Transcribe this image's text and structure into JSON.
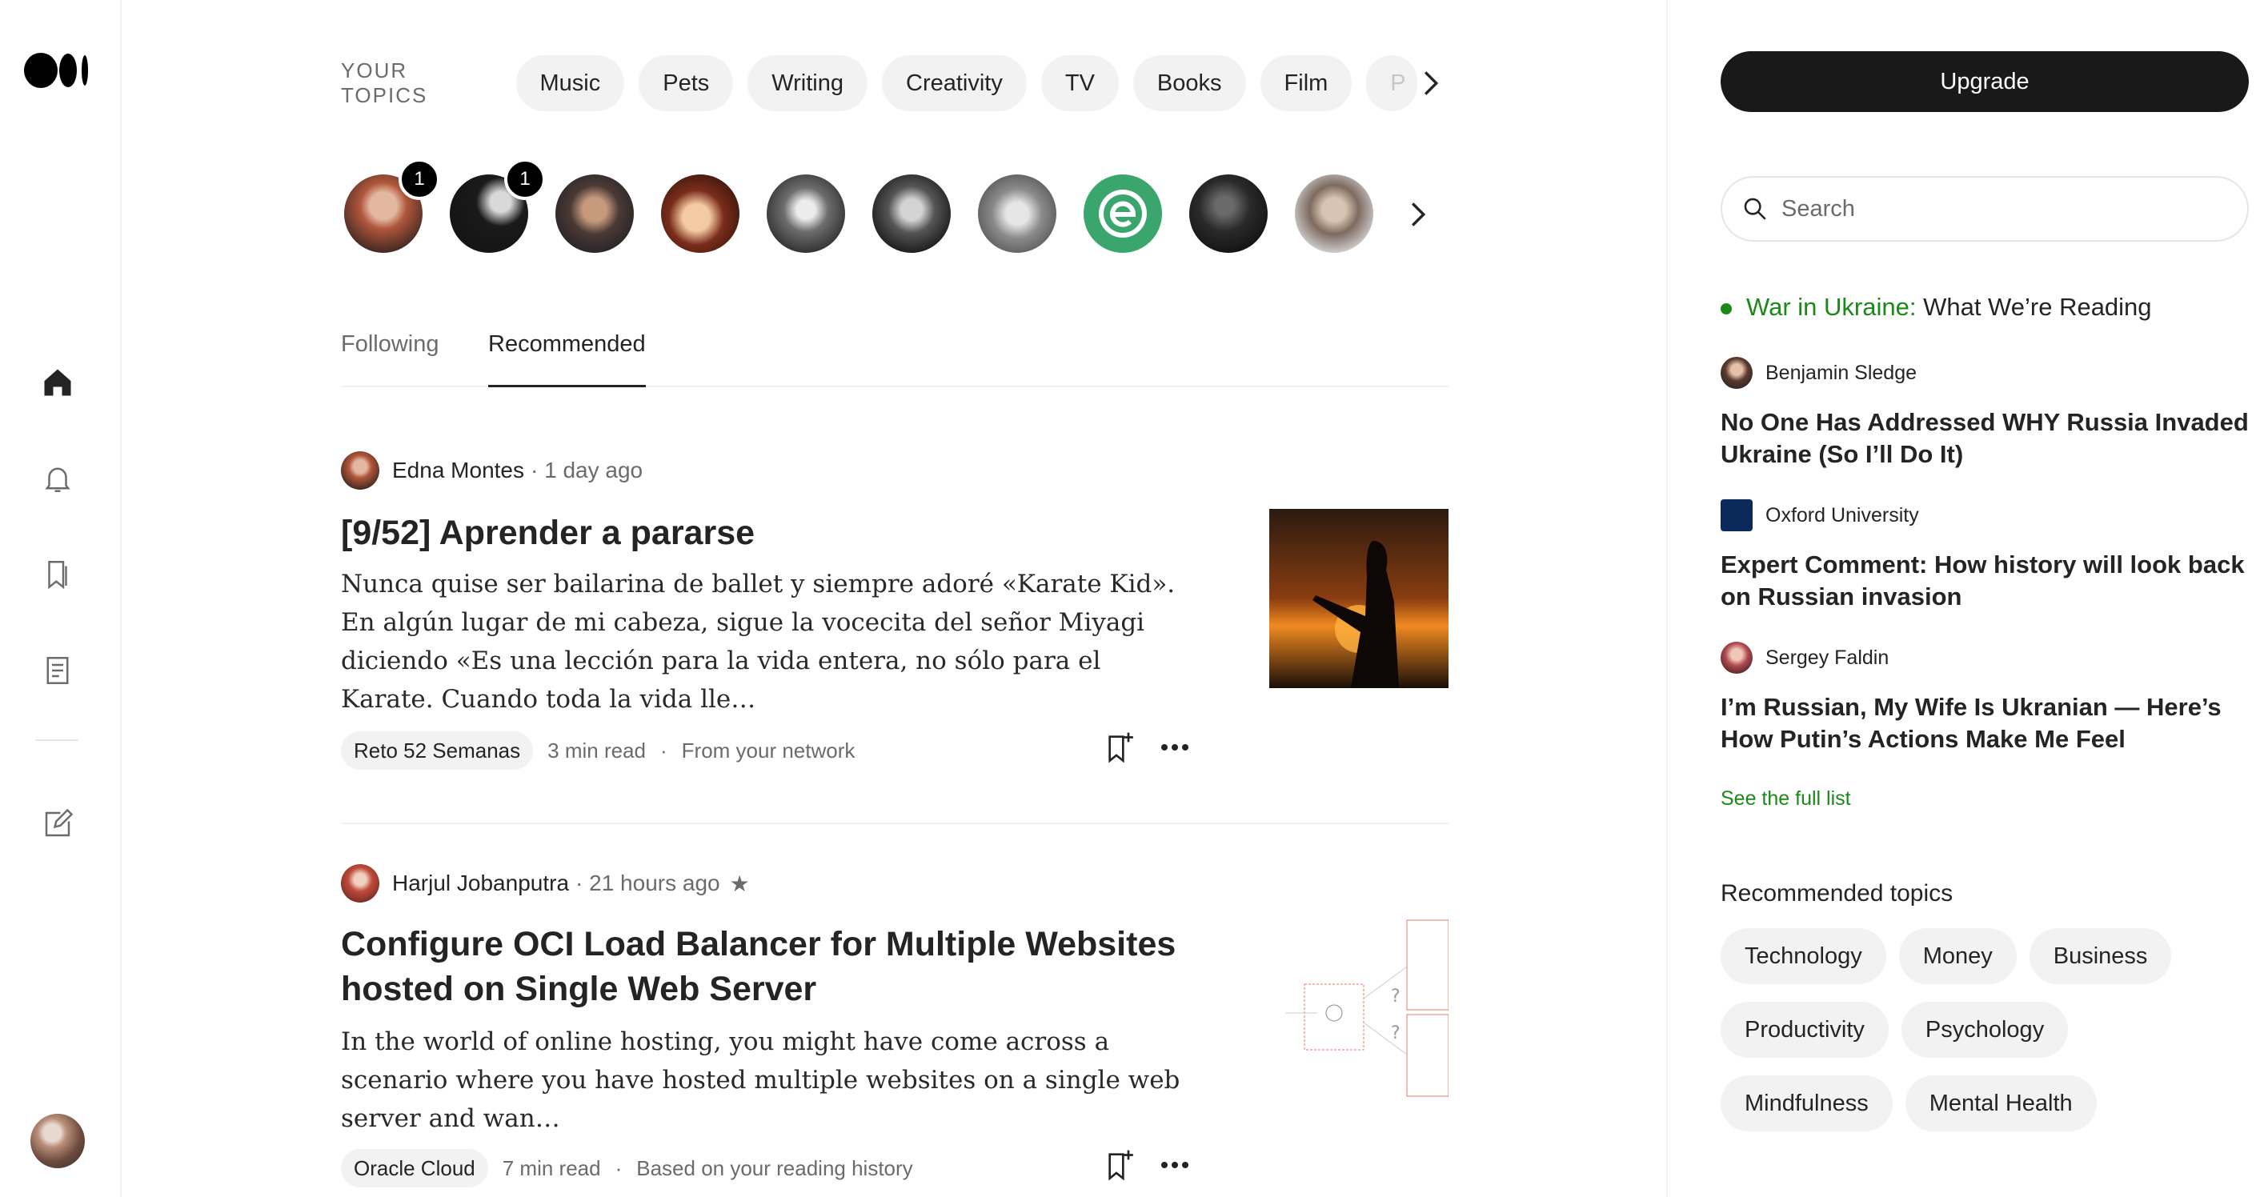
{
  "rail": {
    "icons": [
      "medium-logo",
      "home-icon",
      "bell-icon",
      "bookmark-icon",
      "stories-icon",
      "write-icon"
    ]
  },
  "topics": {
    "label": "YOUR TOPICS",
    "items": [
      "Music",
      "Pets",
      "Writing",
      "Creativity",
      "TV",
      "Books",
      "Film",
      "P"
    ]
  },
  "following_avatars": {
    "badges": [
      "1",
      "1"
    ]
  },
  "tabs": [
    "Following",
    "Recommended"
  ],
  "articles": [
    {
      "author": "Edna Montes",
      "time": "· 1 day ago",
      "title": "[9/52] Aprender a pararse",
      "excerpt": "Nunca quise ser bailarina de ballet y siempre adoré «Karate Kid». En algún lugar de mi cabeza, sigue la vocecita del señor Miyagi diciendo «Es una lección para la vida entera, no sólo para el Karate. Cuando toda la vida lle…",
      "tag": "Reto 52 Semanas",
      "read_time": "3 min read",
      "reason": "From your network"
    },
    {
      "author": "Harjul Jobanputra",
      "time": "· 21 hours ago",
      "star": "★",
      "title": "Configure OCI Load Balancer for Multiple Websites hosted on Single Web Server",
      "excerpt": "In the world of online hosting, you might have come across a scenario where you have hosted multiple websites on a single web server and wan…",
      "tag": "Oracle Cloud",
      "read_time": "7 min read",
      "reason": "Based on your reading history"
    }
  ],
  "sidebar": {
    "upgrade_label": "Upgrade",
    "search_placeholder": "Search",
    "reading_list": {
      "prefix": "War in Ukraine:",
      "title": "What We’re Reading",
      "items": [
        {
          "author": "Benjamin Sledge",
          "title": "No One Has Addressed WHY Russia Invaded Ukraine (So I’ll Do It)"
        },
        {
          "author": "Oxford University",
          "title": "Expert Comment: How history will look back on Russian invasion"
        },
        {
          "author": "Sergey Faldin",
          "title": "I’m Russian, My Wife Is Ukranian — Here’s How Putin’s Actions Make Me Feel"
        }
      ],
      "see_full": "See the full list"
    },
    "recommended_topics": {
      "title": "Recommended topics",
      "items": [
        "Technology",
        "Money",
        "Business",
        "Productivity",
        "Psychology",
        "Mindfulness",
        "Mental Health"
      ]
    }
  },
  "colors": {
    "accent_green": "#1a8917",
    "upgrade_bg": "#191919",
    "pill_bg": "#f2f2f2"
  }
}
